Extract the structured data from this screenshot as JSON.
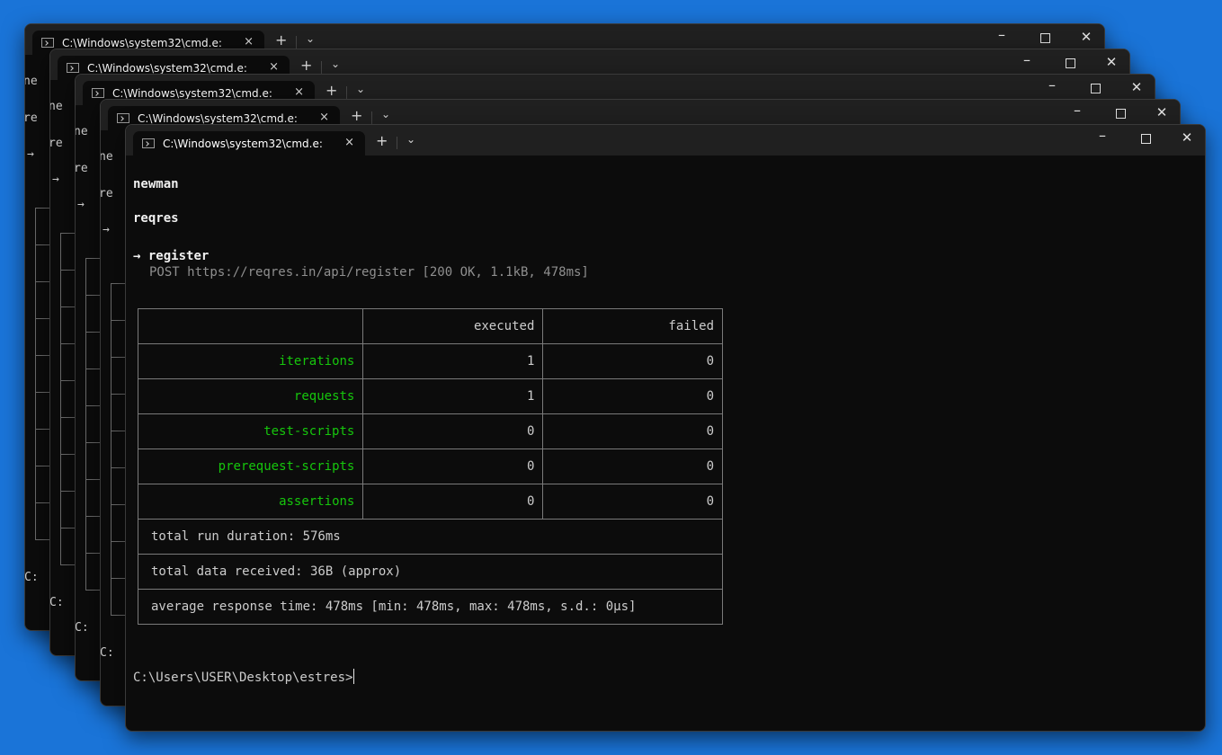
{
  "window": {
    "tab_title": "C:\\Windows\\system32\\cmd.e:",
    "tab_close": "×",
    "new_tab": "+",
    "dropdown": "⌄",
    "minimize": "–",
    "close": "✕"
  },
  "background": {
    "line_newman": "ne",
    "line_reqres": "re",
    "line_arrow": "→",
    "line_prompt": "C:"
  },
  "terminal": {
    "collection_header": "newman",
    "folder": "reqres",
    "request_arrow": "→",
    "request_name": "register",
    "request_detail": "POST https://reqres.in/api/register [200 OK, 1.1kB, 478ms]",
    "table": {
      "headers": [
        "",
        "executed",
        "failed"
      ],
      "rows": [
        {
          "metric": "iterations",
          "executed": "1",
          "failed": "0"
        },
        {
          "metric": "requests",
          "executed": "1",
          "failed": "0"
        },
        {
          "metric": "test-scripts",
          "executed": "0",
          "failed": "0"
        },
        {
          "metric": "prerequest-scripts",
          "executed": "0",
          "failed": "0"
        },
        {
          "metric": "assertions",
          "executed": "0",
          "failed": "0"
        }
      ],
      "total_run_duration": "total run duration: 576ms",
      "total_data_received": "total data received: 36B (approx)",
      "average_response_time": "average response time: 478ms [min: 478ms, max: 478ms, s.d.: 0µs]"
    },
    "prompt": "C:\\Users\\USER\\Desktop\\estres>"
  }
}
